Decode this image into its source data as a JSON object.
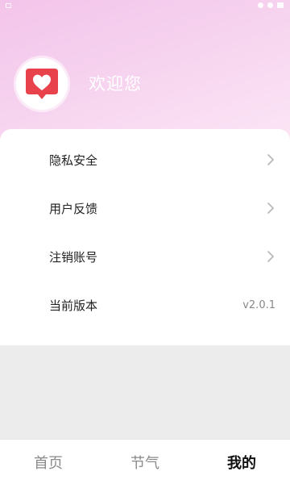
{
  "header": {
    "welcome_text": "欢迎您",
    "avatar_icon": "heart-bubble-icon",
    "accent_color": "#e8434d"
  },
  "menu": {
    "items": [
      {
        "label": "隐私安全",
        "icon": "chevron-right-icon"
      },
      {
        "label": "用户反馈",
        "icon": "chevron-right-icon"
      },
      {
        "label": "注销账号",
        "icon": "chevron-right-icon"
      },
      {
        "label": "当前版本",
        "value": "v2.0.1"
      }
    ]
  },
  "bottom_nav": {
    "tabs": [
      {
        "label": "首页",
        "active": false
      },
      {
        "label": "节气",
        "active": false
      },
      {
        "label": "我的",
        "active": true
      }
    ]
  }
}
